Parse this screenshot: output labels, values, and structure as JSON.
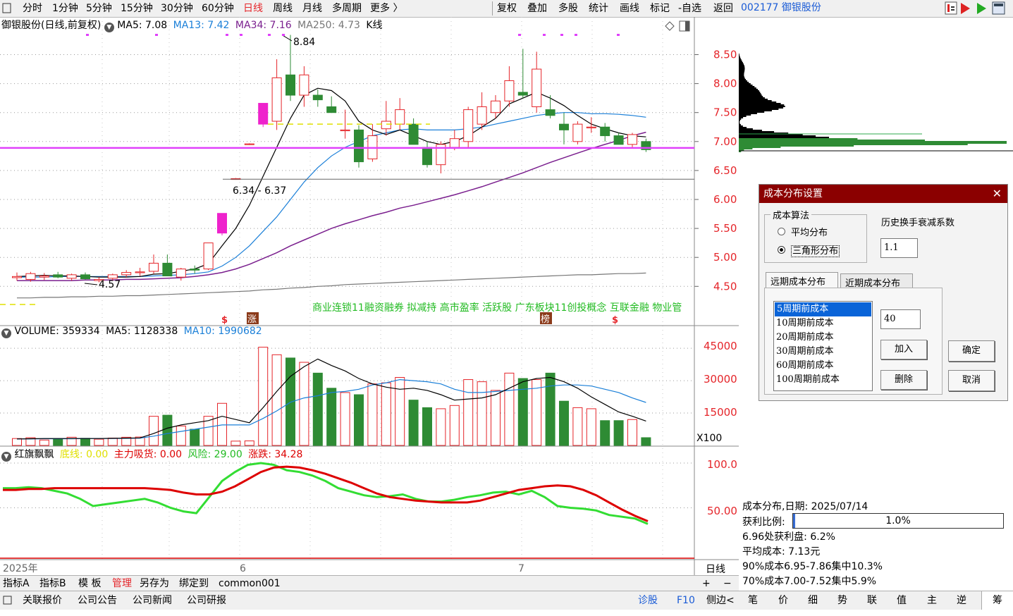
{
  "toolbar": {
    "periods": [
      "分时",
      "1分钟",
      "5分钟",
      "15分钟",
      "30分钟",
      "60分钟",
      "日线",
      "周线",
      "月线",
      "多周期",
      "更多 〉"
    ],
    "active_period": "日线",
    "tools": [
      "复权",
      "叠加",
      "多股",
      "统计",
      "画线",
      "标记",
      "-自选",
      "返回"
    ]
  },
  "stock": {
    "code_name": "002177 御银股份"
  },
  "main_legend": {
    "title": "御银股份(日线,前复权)",
    "ma5": "MA5: 7.08",
    "ma13": "MA13: 7.42",
    "ma34": "MA34: 7.16",
    "ma250": "MA250: 4.73",
    "kline": "K线"
  },
  "annotations": {
    "high": "8.84",
    "range": "6.34 - 6.37",
    "low": "4.57",
    "concepts": "商业连锁11融资融券 拟减持 高市盈率 活跃股 广东板块11创投概念 互联金融 物业管",
    "zhang": "涨",
    "bang": "榜",
    "s1": "$",
    "s2": "$"
  },
  "price_axis": [
    "8.50",
    "8.00",
    "7.50",
    "7.00",
    "6.50",
    "6.00",
    "5.50",
    "5.00",
    "4.50"
  ],
  "volume_legend": {
    "volume": "VOLUME: 359334",
    "ma5": "MA5: 1128338",
    "ma10": "MA10: 1990682"
  },
  "volume_axis": [
    "45000",
    "30000",
    "15000"
  ],
  "volume_unit": "X100",
  "indicator_legend": {
    "name": "红旗飘飘",
    "dixian": "底线: 0.00",
    "zhuli": "主力吸货: 0.00",
    "fengxian": "风险: 29.00",
    "zhangdie": "涨跌: 34.28"
  },
  "indicator_axis": [
    "100.0",
    "50.00"
  ],
  "date_axis": {
    "year": "2025年",
    "m6": "6",
    "m7": "7",
    "period": "日线"
  },
  "bottom_tabs": [
    "指标A",
    "指标B",
    "模 板",
    "管理",
    "另存为",
    "绑定到",
    "common001"
  ],
  "zoom": {
    "plus": "+",
    "minus": "−"
  },
  "status_bar": {
    "left": [
      "关联报价",
      "公司公告",
      "公司新闻",
      "公司研报"
    ],
    "right": [
      "诊股",
      "F10",
      "侧边<"
    ],
    "tabs": [
      "笔",
      "价",
      "细",
      "势",
      "联",
      "值",
      "主",
      "逆",
      "筹"
    ]
  },
  "dialog": {
    "title": "成本分布设置",
    "algo_group": "成本算法",
    "opt1": "平均分布",
    "opt2": "三角形分布",
    "decay_label": "历史换手衰减系数",
    "decay_value": "1.1",
    "tab_far": "远期成本分布",
    "tab_near": "近期成本分布",
    "list": [
      "5周期前成本",
      "10周期前成本",
      "20周期前成本",
      "30周期前成本",
      "60周期前成本",
      "100周期前成本"
    ],
    "list_input": "40",
    "add": "加入",
    "delete": "删除",
    "ok": "确定",
    "cancel": "取消"
  },
  "cost_info": {
    "date_line": "成本分布,日期: 2025/07/14",
    "profit_label": "获利比例:",
    "profit_value": "1.0%",
    "profit_ratio": 0.01,
    "line1": "6.96处获利盘: 6.2%",
    "line2": "平均成本: 7.13元",
    "line3": "90%成本6.95-7.86集中10.3%",
    "line4": "70%成本7.00-7.52集中5.9%"
  },
  "colors": {
    "up": "#e5252a",
    "down": "#2e8b34",
    "ma5": "#000000",
    "ma13": "#1a7fd8",
    "ma34": "#7a1f8e",
    "ma250": "#777777",
    "highlight": "#e040fb",
    "indicator_red": "#dd0000",
    "indicator_green": "#33dd33"
  },
  "chart_data": {
    "type": "candlestick",
    "candles": [
      {
        "o": 4.65,
        "h": 4.74,
        "l": 4.6,
        "c": 4.67
      },
      {
        "o": 4.62,
        "h": 4.75,
        "l": 4.58,
        "c": 4.72
      },
      {
        "o": 4.66,
        "h": 4.73,
        "l": 4.61,
        "c": 4.68
      },
      {
        "o": 4.7,
        "h": 4.75,
        "l": 4.64,
        "c": 4.66
      },
      {
        "o": 4.64,
        "h": 4.72,
        "l": 4.6,
        "c": 4.7
      },
      {
        "o": 4.7,
        "h": 4.74,
        "l": 4.62,
        "c": 4.63
      },
      {
        "o": 4.6,
        "h": 4.66,
        "l": 4.57,
        "c": 4.62
      },
      {
        "o": 4.64,
        "h": 4.72,
        "l": 4.6,
        "c": 4.7
      },
      {
        "o": 4.7,
        "h": 4.78,
        "l": 4.66,
        "c": 4.74
      },
      {
        "o": 4.75,
        "h": 4.82,
        "l": 4.68,
        "c": 4.75
      },
      {
        "o": 4.76,
        "h": 5.05,
        "l": 4.72,
        "c": 4.9
      },
      {
        "o": 4.9,
        "h": 5.05,
        "l": 4.68,
        "c": 4.68
      },
      {
        "o": 4.66,
        "h": 4.82,
        "l": 4.6,
        "c": 4.8
      },
      {
        "o": 4.8,
        "h": 4.86,
        "l": 4.72,
        "c": 4.78
      },
      {
        "o": 4.8,
        "h": 5.25,
        "l": 4.78,
        "c": 5.25
      },
      {
        "o": 5.42,
        "h": 5.76,
        "l": 5.38,
        "c": 5.76
      },
      {
        "o": 6.35,
        "h": 6.37,
        "l": 6.34,
        "c": 6.36
      },
      {
        "o": 6.95,
        "h": 6.97,
        "l": 6.94,
        "c": 6.96
      },
      {
        "o": 7.3,
        "h": 7.66,
        "l": 7.25,
        "c": 7.66
      },
      {
        "o": 7.35,
        "h": 8.42,
        "l": 7.2,
        "c": 8.1
      },
      {
        "o": 8.15,
        "h": 8.84,
        "l": 7.7,
        "c": 7.8
      },
      {
        "o": 7.8,
        "h": 8.3,
        "l": 7.6,
        "c": 8.15
      },
      {
        "o": 7.8,
        "h": 7.9,
        "l": 7.6,
        "c": 7.72
      },
      {
        "o": 7.6,
        "h": 7.78,
        "l": 7.5,
        "c": 7.5
      },
      {
        "o": 7.2,
        "h": 7.55,
        "l": 7.05,
        "c": 7.2
      },
      {
        "o": 7.2,
        "h": 7.28,
        "l": 6.55,
        "c": 6.65
      },
      {
        "o": 6.7,
        "h": 7.3,
        "l": 6.65,
        "c": 7.1
      },
      {
        "o": 7.22,
        "h": 7.7,
        "l": 7.1,
        "c": 7.35
      },
      {
        "o": 7.3,
        "h": 7.75,
        "l": 7.2,
        "c": 7.55
      },
      {
        "o": 7.3,
        "h": 7.4,
        "l": 6.95,
        "c": 6.95
      },
      {
        "o": 6.9,
        "h": 7.0,
        "l": 6.55,
        "c": 6.6
      },
      {
        "o": 6.6,
        "h": 7.0,
        "l": 6.45,
        "c": 6.95
      },
      {
        "o": 6.9,
        "h": 7.2,
        "l": 6.85,
        "c": 7.05
      },
      {
        "o": 7.0,
        "h": 7.6,
        "l": 6.9,
        "c": 7.55
      },
      {
        "o": 7.3,
        "h": 7.85,
        "l": 7.2,
        "c": 7.6
      },
      {
        "o": 7.5,
        "h": 7.8,
        "l": 7.4,
        "c": 7.7
      },
      {
        "o": 7.7,
        "h": 8.3,
        "l": 7.6,
        "c": 8.05
      },
      {
        "o": 7.85,
        "h": 8.6,
        "l": 7.75,
        "c": 7.8
      },
      {
        "o": 7.6,
        "h": 8.55,
        "l": 7.5,
        "c": 8.25
      },
      {
        "o": 7.55,
        "h": 7.8,
        "l": 7.4,
        "c": 7.45
      },
      {
        "o": 7.3,
        "h": 7.5,
        "l": 6.95,
        "c": 7.2
      },
      {
        "o": 7.0,
        "h": 7.35,
        "l": 6.95,
        "c": 7.3
      },
      {
        "o": 7.25,
        "h": 7.42,
        "l": 7.15,
        "c": 7.25
      },
      {
        "o": 7.25,
        "h": 7.32,
        "l": 7.0,
        "c": 7.1
      },
      {
        "o": 7.1,
        "h": 7.15,
        "l": 6.95,
        "c": 6.95
      },
      {
        "o": 6.95,
        "h": 7.15,
        "l": 6.9,
        "c": 7.12
      },
      {
        "o": 7.0,
        "h": 7.05,
        "l": 6.82,
        "c": 6.86
      }
    ],
    "ma5": [
      4.67,
      4.68,
      4.69,
      4.68,
      4.68,
      4.67,
      4.66,
      4.66,
      4.66,
      4.67,
      4.71,
      4.72,
      4.76,
      4.8,
      4.89,
      5.2,
      5.5,
      5.9,
      6.4,
      6.9,
      7.4,
      7.8,
      7.92,
      7.88,
      7.7,
      7.35,
      7.2,
      7.12,
      7.2,
      7.1,
      7.0,
      6.95,
      7.0,
      7.1,
      7.25,
      7.4,
      7.65,
      7.75,
      7.85,
      7.75,
      7.62,
      7.45,
      7.3,
      7.22,
      7.15,
      7.1,
      7.08
    ],
    "ma13": [
      4.66,
      4.66,
      4.66,
      4.67,
      4.67,
      4.67,
      4.67,
      4.67,
      4.67,
      4.67,
      4.68,
      4.69,
      4.7,
      4.72,
      4.75,
      4.85,
      5.0,
      5.2,
      5.45,
      5.7,
      6.0,
      6.3,
      6.55,
      6.75,
      6.9,
      7.0,
      7.1,
      7.15,
      7.2,
      7.22,
      7.2,
      7.2,
      7.2,
      7.22,
      7.25,
      7.3,
      7.35,
      7.4,
      7.45,
      7.48,
      7.5,
      7.5,
      7.48,
      7.48,
      7.47,
      7.45,
      7.42
    ],
    "ma34": [
      4.6,
      4.6,
      4.6,
      4.6,
      4.6,
      4.61,
      4.61,
      4.61,
      4.62,
      4.62,
      4.63,
      4.64,
      4.65,
      4.67,
      4.7,
      4.74,
      4.8,
      4.88,
      4.98,
      5.08,
      5.2,
      5.3,
      5.4,
      5.5,
      5.58,
      5.65,
      5.72,
      5.78,
      5.85,
      5.9,
      5.96,
      6.02,
      6.08,
      6.15,
      6.22,
      6.3,
      6.38,
      6.46,
      6.55,
      6.64,
      6.72,
      6.8,
      6.88,
      6.95,
      7.02,
      7.1,
      7.16
    ],
    "ma250": [
      4.3,
      4.3,
      4.31,
      4.31,
      4.32,
      4.32,
      4.33,
      4.33,
      4.34,
      4.34,
      4.35,
      4.36,
      4.37,
      4.38,
      4.39,
      4.4,
      4.41,
      4.42,
      4.44,
      4.45,
      4.47,
      4.48,
      4.5,
      4.51,
      4.53,
      4.54,
      4.55,
      4.56,
      4.57,
      4.58,
      4.59,
      4.6,
      4.61,
      4.62,
      4.63,
      4.64,
      4.65,
      4.66,
      4.67,
      4.68,
      4.69,
      4.7,
      4.7,
      4.71,
      4.72,
      4.72,
      4.73
    ],
    "volume": [
      3200,
      3600,
      2500,
      3100,
      3800,
      3300,
      2900,
      3400,
      3800,
      3900,
      13500,
      14000,
      9000,
      7500,
      13500,
      19500,
      2000,
      2100,
      45500,
      42000,
      40500,
      38500,
      33500,
      26500,
      24500,
      23500,
      28500,
      29000,
      31500,
      21000,
      17500,
      17000,
      18500,
      30500,
      29500,
      25500,
      33500,
      31000,
      30500,
      33500,
      20500,
      17500,
      17000,
      11500,
      11500,
      12000,
      3600
    ],
    "vol_ma5": [
      3000,
      3100,
      3200,
      3200,
      3200,
      3200,
      3200,
      3300,
      3400,
      3500,
      5500,
      8000,
      9500,
      10500,
      11500,
      13500,
      12000,
      10500,
      17500,
      25000,
      32000,
      36500,
      40000,
      37000,
      34500,
      31000,
      28500,
      27000,
      26000,
      26500,
      25500,
      23500,
      21000,
      21500,
      22000,
      23500,
      26500,
      29500,
      31000,
      31500,
      29500,
      26500,
      22500,
      19000,
      15500,
      13500,
      11300
    ],
    "vol_ma10": [
      3000,
      3000,
      3100,
      3100,
      3100,
      3200,
      3200,
      3200,
      3300,
      3400,
      4300,
      5500,
      6500,
      7500,
      8500,
      9500,
      9500,
      9500,
      12500,
      16000,
      20000,
      22000,
      23000,
      24500,
      25000,
      26000,
      28000,
      29000,
      30500,
      30000,
      29500,
      28500,
      26000,
      24500,
      24500,
      25000,
      25500,
      26000,
      26500,
      27500,
      28000,
      28000,
      27500,
      26000,
      24500,
      22000,
      19900
    ],
    "ind_red": [
      70,
      70,
      71,
      71,
      72,
      72,
      72,
      72,
      72,
      72,
      72,
      72,
      71,
      70,
      67,
      65,
      65,
      68,
      74,
      82,
      90,
      95,
      96,
      95,
      92,
      88,
      83,
      78,
      72,
      66,
      62,
      60,
      58,
      57,
      56,
      56,
      56,
      58,
      62,
      66,
      70,
      72,
      74,
      75,
      74,
      70,
      64,
      56,
      48,
      41,
      35
    ],
    "ind_green": [
      72,
      72,
      73,
      72,
      69,
      66,
      60,
      52,
      54,
      56,
      58,
      60,
      56,
      50,
      46,
      44,
      62,
      80,
      90,
      98,
      100,
      98,
      92,
      90,
      86,
      80,
      72,
      68,
      64,
      62,
      63,
      65,
      60,
      57,
      57,
      59,
      62,
      64,
      67,
      68,
      65,
      69,
      62,
      52,
      50,
      49,
      47,
      42,
      40,
      38,
      32
    ]
  }
}
